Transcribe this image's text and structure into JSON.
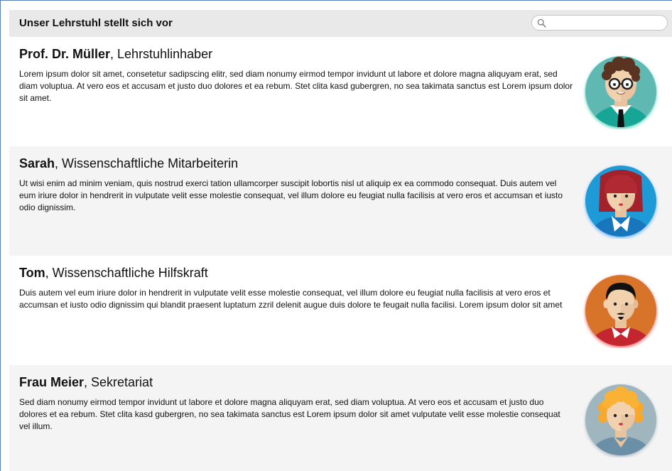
{
  "header": {
    "title": "Unser Lehrstuhl stellt sich vor",
    "search": {
      "placeholder": "",
      "value": ""
    }
  },
  "people": [
    {
      "name": "Prof. Dr. Müller",
      "role": ", Lehrstuhlinhaber",
      "text": "Lorem ipsum dolor sit amet, consetetur sadipscing elitr, sed diam nonumy eirmod tempor invidunt ut labore et dolore magna aliquyam erat, sed diam voluptua. At vero eos et accusam et justo duo dolores et ea rebum. Stet clita kasd gubergren, no sea takimata sanctus est Lorem ipsum dolor sit amet.",
      "avatar_bg": "#5fb8b2",
      "avatar_glow": "#23c4a6"
    },
    {
      "name": "Sarah",
      "role": ", Wissenschaftliche Mitarbeiterin",
      "text": "Ut wisi enim ad minim veniam, quis nostrud exerci tation ullamcorper suscipit lobortis nisl ut aliquip ex ea commodo consequat. Duis autem vel eum iriure dolor in hendrerit in vulputate velit esse molestie consequat, vel illum dolore eu feugiat nulla facilisis at vero eros et accumsan et iusto odio dignissim.",
      "avatar_bg": "#1e9ad6",
      "avatar_glow": "#3aa0ff"
    },
    {
      "name": "Tom",
      "role": ", Wissenschaftliche Hilfskraft",
      "text": "Duis autem vel eum iriure dolor in hendrerit in vulputate velit esse molestie consequat, vel illum dolore eu feugiat nulla facilisis at vero eros et accumsan et iusto odio dignissim qui blandit praesent luptatum zzril delenit augue duis dolore te feugait nulla facilisi. Lorem ipsum dolor sit amet",
      "avatar_bg": "#d8742a",
      "avatar_glow": "#e63030"
    },
    {
      "name": "Frau Meier",
      "role": ", Sekretariat",
      "text": "Sed diam nonumy eirmod tempor invidunt ut labore et dolore magna aliquyam erat, sed diam voluptua. At vero eos et accusam et justo duo dolores et ea rebum. Stet clita kasd gubergren, no sea takimata sanctus est Lorem ipsum dolor sit amet vulputate velit esse molestie consequat vel illum.",
      "avatar_bg": "#9fb6bf",
      "avatar_glow": "#9aa9b3"
    }
  ],
  "icons": {
    "search": "search-icon",
    "avatars": [
      "professor-avatar-icon",
      "woman-avatar-icon",
      "man-avatar-icon",
      "secretary-avatar-icon"
    ]
  }
}
